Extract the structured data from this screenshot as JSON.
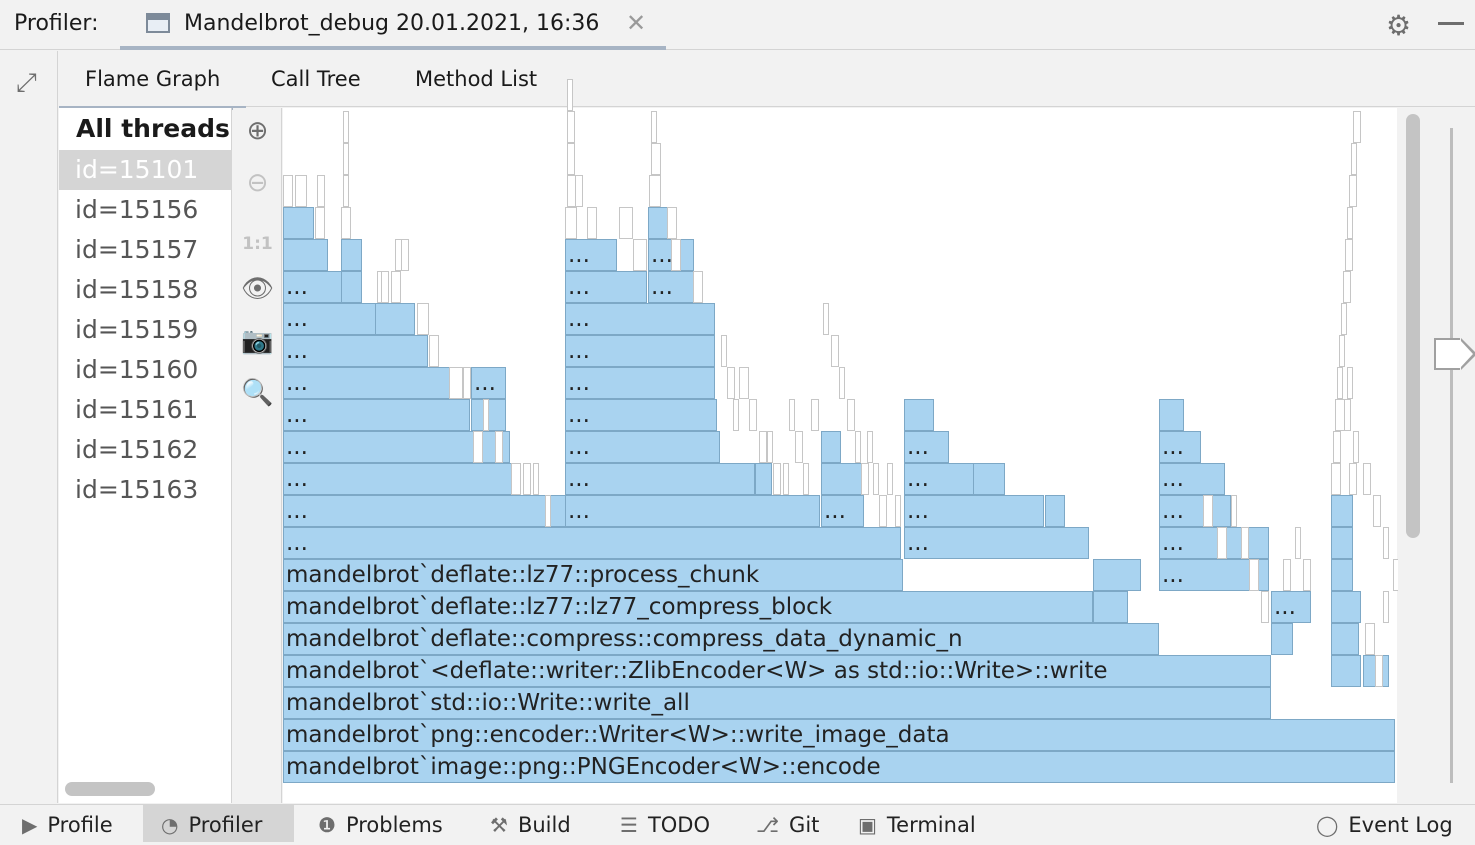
{
  "topbar": {
    "label": "Profiler:",
    "file_tab": {
      "title": "Mandelbrot_debug 20.01.2021, 16:36",
      "close_glyph": "✕",
      "icon": "profiler-file-icon"
    },
    "settings_icon": "gear-icon",
    "minimize_icon": "minimize-icon"
  },
  "tabs": [
    {
      "label": "Flame Graph",
      "active": true
    },
    {
      "label": "Call Tree",
      "active": false
    },
    {
      "label": "Method List",
      "active": false
    }
  ],
  "threads": {
    "header": "All threads",
    "items": [
      "id=15101",
      "id=15156",
      "id=15157",
      "id=15158",
      "id=15159",
      "id=15160",
      "id=15161",
      "id=15162",
      "id=15163"
    ],
    "selected": "id=15101"
  },
  "tools": [
    {
      "name": "zoom-in-icon",
      "glyph": "⊕",
      "enabled": true
    },
    {
      "name": "zoom-out-icon",
      "glyph": "⊖",
      "enabled": false
    },
    {
      "name": "actual-size-icon",
      "glyph": "1:1",
      "enabled": false
    },
    {
      "name": "eye-icon",
      "glyph": "👁",
      "enabled": true
    },
    {
      "name": "camera-icon",
      "glyph": "📷",
      "enabled": true
    },
    {
      "name": "search-icon",
      "glyph": "🔍",
      "enabled": true
    }
  ],
  "flame": {
    "frames": [
      "mandelbrot`image::png::PNGEncoder<W>::encode",
      "mandelbrot`png::encoder::Writer<W>::write_image_data",
      "mandelbrot`std::io::Write::write_all",
      "mandelbrot`<deflate::writer::ZlibEncoder<W> as std::io::Write>::write",
      "mandelbrot`deflate::compress::compress_data_dynamic_n",
      "mandelbrot`deflate::lz77::lz77_compress_block",
      "mandelbrot`deflate::lz77::process_chunk"
    ],
    "ellipsis": "..."
  },
  "bottombar": [
    {
      "label": "Profile",
      "icon": "play-icon",
      "glyph": "▶",
      "active": false
    },
    {
      "label": "Profiler",
      "icon": "profiler-icon",
      "glyph": "◔",
      "active": true
    },
    {
      "label": "Problems",
      "icon": "problems-icon",
      "glyph": "❶",
      "active": false
    },
    {
      "label": "Build",
      "icon": "hammer-icon",
      "glyph": "⚒",
      "active": false
    },
    {
      "label": "TODO",
      "icon": "list-icon",
      "glyph": "☰",
      "active": false
    },
    {
      "label": "Git",
      "icon": "git-icon",
      "glyph": "⎇",
      "active": false
    },
    {
      "label": "Terminal",
      "icon": "terminal-icon",
      "glyph": "▣",
      "active": false
    },
    {
      "label": "Event Log",
      "icon": "event-log-icon",
      "glyph": "◯",
      "active": false
    }
  ]
}
